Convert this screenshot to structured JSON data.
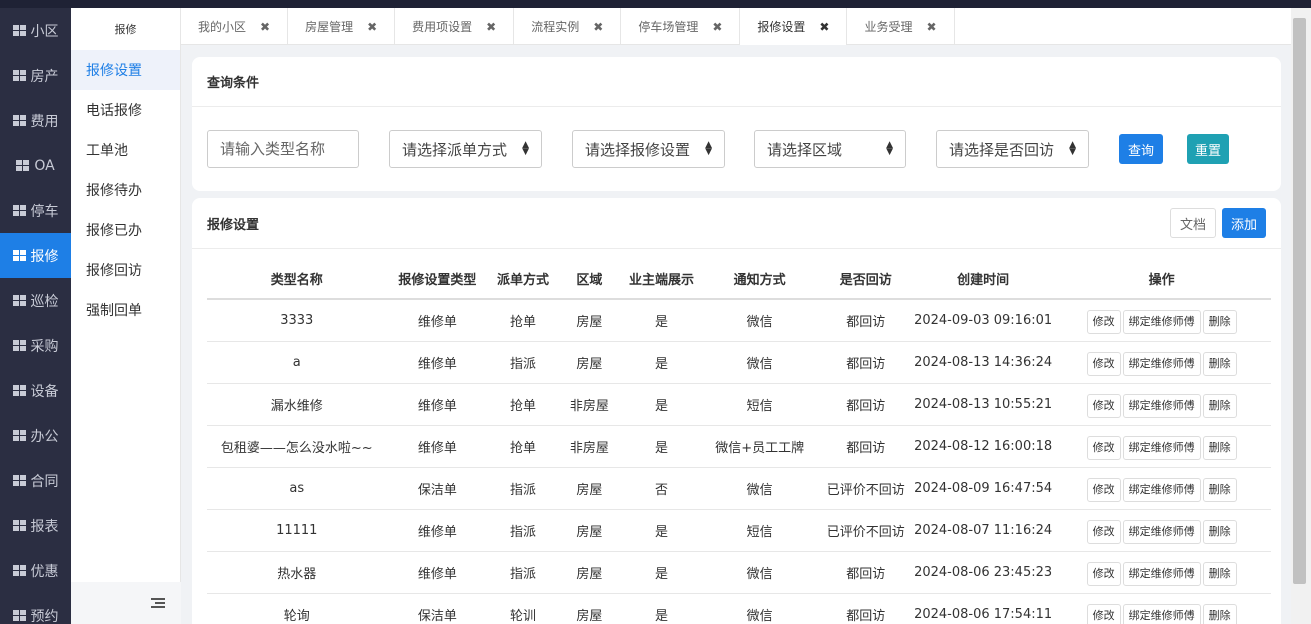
{
  "sidebar": {
    "items": [
      {
        "label": "小区",
        "active": false
      },
      {
        "label": "房产",
        "active": false
      },
      {
        "label": "费用",
        "active": false
      },
      {
        "label": "OA",
        "active": false
      },
      {
        "label": "停车",
        "active": false
      },
      {
        "label": "报修",
        "active": true
      },
      {
        "label": "巡检",
        "active": false
      },
      {
        "label": "采购",
        "active": false
      },
      {
        "label": "设备",
        "active": false
      },
      {
        "label": "办公",
        "active": false
      },
      {
        "label": "合同",
        "active": false
      },
      {
        "label": "报表",
        "active": false
      },
      {
        "label": "优惠",
        "active": false
      },
      {
        "label": "预约",
        "active": false
      }
    ]
  },
  "subnav": {
    "title": "报修",
    "items": [
      {
        "label": "报修设置",
        "active": true
      },
      {
        "label": "电话报修",
        "active": false
      },
      {
        "label": "工单池",
        "active": false
      },
      {
        "label": "报修待办",
        "active": false
      },
      {
        "label": "报修已办",
        "active": false
      },
      {
        "label": "报修回访",
        "active": false
      },
      {
        "label": "强制回单",
        "active": false
      }
    ]
  },
  "tabs": [
    {
      "label": "我的小区",
      "active": false
    },
    {
      "label": "房屋管理",
      "active": false
    },
    {
      "label": "费用项设置",
      "active": false
    },
    {
      "label": "流程实例",
      "active": false
    },
    {
      "label": "停车场管理",
      "active": false
    },
    {
      "label": "报修设置",
      "active": true
    },
    {
      "label": "业务受理",
      "active": false
    }
  ],
  "search": {
    "title": "查询条件",
    "type_name_placeholder": "请输入类型名称",
    "dispatch_select": "请选择派单方式",
    "setting_select": "请选择报修设置",
    "area_select": "请选择区域",
    "revisit_select": "请选择是否回访",
    "query_label": "查询",
    "reset_label": "重置"
  },
  "list": {
    "title": "报修设置",
    "doc_label": "文档",
    "add_label": "添加",
    "columns": [
      "类型名称",
      "报修设置类型",
      "派单方式",
      "区域",
      "业主端展示",
      "通知方式",
      "是否回访",
      "创建时间",
      "操作"
    ],
    "actions": [
      "修改",
      "绑定维修师傅",
      "删除"
    ],
    "rows": [
      [
        "3333",
        "维修单",
        "抢单",
        "房屋",
        "是",
        "微信",
        "都回访",
        "2024-09-03 09:16:01"
      ],
      [
        "a",
        "维修单",
        "指派",
        "房屋",
        "是",
        "微信",
        "都回访",
        "2024-08-13 14:36:24"
      ],
      [
        "漏水维修",
        "维修单",
        "抢单",
        "非房屋",
        "是",
        "短信",
        "都回访",
        "2024-08-13 10:55:21"
      ],
      [
        "包租婆——怎么没水啦~~",
        "维修单",
        "抢单",
        "非房屋",
        "是",
        "微信+员工工牌",
        "都回访",
        "2024-08-12 16:00:18"
      ],
      [
        "as",
        "保洁单",
        "指派",
        "房屋",
        "否",
        "微信",
        "已评价不回访",
        "2024-08-09 16:47:54"
      ],
      [
        "11111",
        "维修单",
        "指派",
        "房屋",
        "是",
        "短信",
        "已评价不回访",
        "2024-08-07 11:16:24"
      ],
      [
        "热水器",
        "维修单",
        "指派",
        "房屋",
        "是",
        "微信",
        "都回访",
        "2024-08-06 23:45:23"
      ],
      [
        "轮询",
        "保洁单",
        "轮训",
        "房屋",
        "是",
        "微信",
        "都回访",
        "2024-08-06 17:54:11"
      ]
    ]
  },
  "colors": {
    "accent": "#1e7fe6",
    "reset": "#1fa1b3",
    "sidebar_bg": "#2b2e42"
  }
}
